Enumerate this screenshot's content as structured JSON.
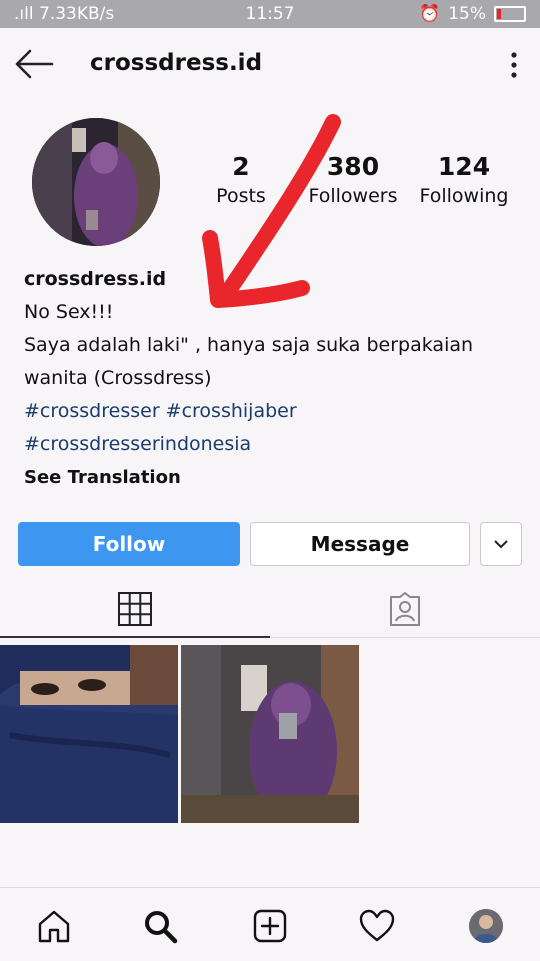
{
  "status_bar": {
    "left": ".ıll 7.33KB/s",
    "time": "11:57",
    "battery": "15%",
    "battery_level": 0.15,
    "battery_color": "#e8232b"
  },
  "header": {
    "title": "crossdress.id"
  },
  "stats": [
    {
      "value": "2",
      "label": "Posts"
    },
    {
      "value": "380",
      "label": "Followers"
    },
    {
      "value": "124",
      "label": "Following"
    }
  ],
  "bio": {
    "name": "crossdress.id",
    "line1": "No Sex!!!",
    "line2": "Saya adalah laki\" , hanya saja suka berpakaian",
    "line3": "wanita (Crossdress)",
    "tags1": "#crossdresser #crosshijaber",
    "tags2": "#crossdresserindonesia",
    "translate": "See Translation"
  },
  "buttons": {
    "follow": "Follow",
    "message": "Message",
    "follow_color": "#3d96f0"
  },
  "tabs": [
    {
      "icon": "grid-icon",
      "active": true
    },
    {
      "icon": "tagged-icon",
      "active": false
    }
  ],
  "nav": [
    "home-icon",
    "search-icon",
    "add-icon",
    "heart-icon",
    "profile-avatar"
  ],
  "accent": {
    "arrow": "#e8262c"
  }
}
